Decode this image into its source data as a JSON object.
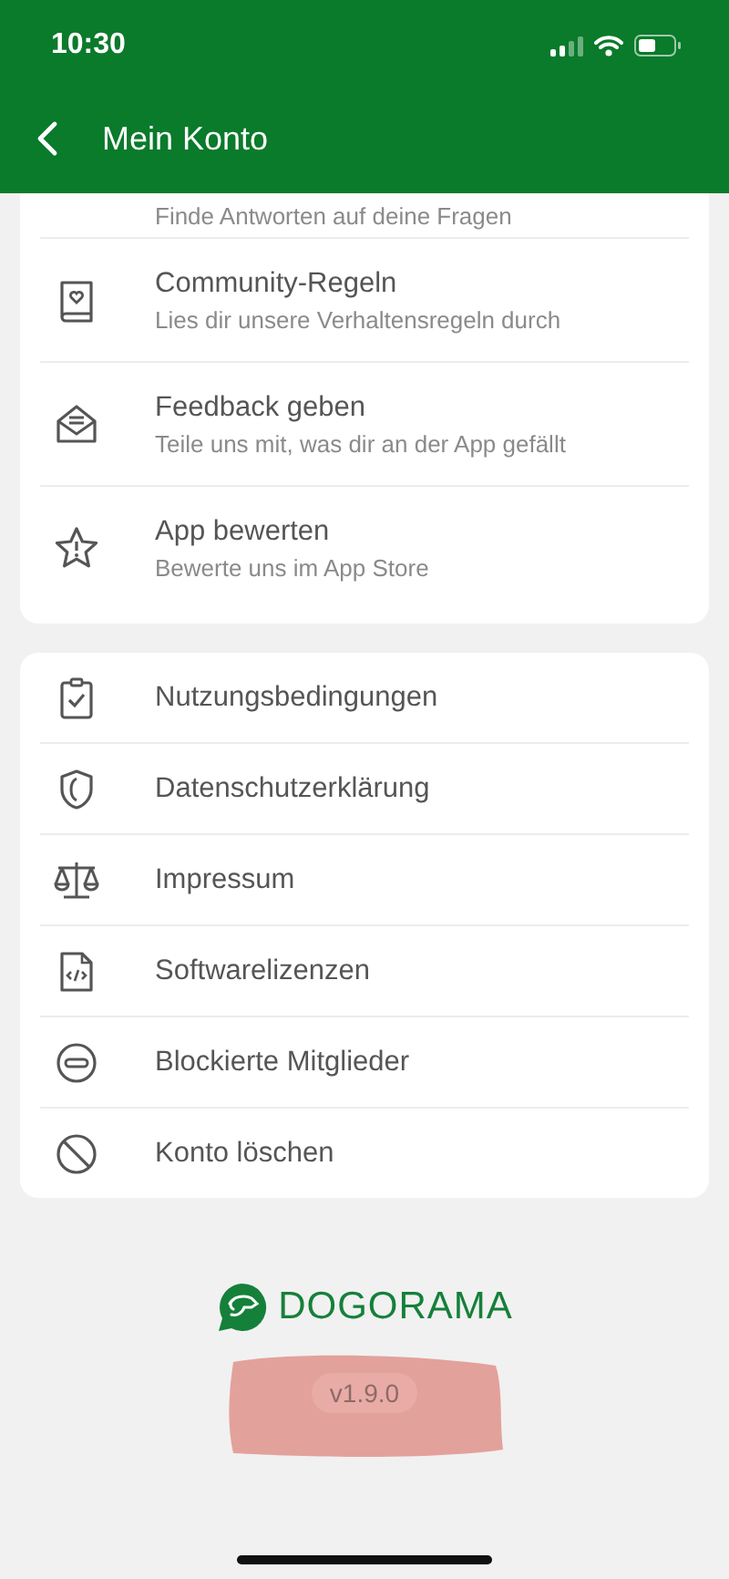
{
  "status_bar": {
    "time": "10:30"
  },
  "header": {
    "title": "Mein Konto"
  },
  "sections": [
    {
      "items": [
        {
          "subtitle": "Finde Antworten auf deine Fragen"
        },
        {
          "title": "Community-Regeln",
          "subtitle": "Lies dir unsere Verhaltensregeln durch"
        },
        {
          "title": "Feedback geben",
          "subtitle": "Teile uns mit, was dir an der App gefällt"
        },
        {
          "title": "App bewerten",
          "subtitle": "Bewerte uns im App Store"
        }
      ]
    },
    {
      "items": [
        {
          "title": "Nutzungsbedingungen"
        },
        {
          "title": "Datenschutzerklärung"
        },
        {
          "title": "Impressum"
        },
        {
          "title": "Softwarelizenzen"
        },
        {
          "title": "Blockierte Mitglieder"
        },
        {
          "title": "Konto löschen"
        }
      ]
    }
  ],
  "footer": {
    "logo_text": "DOGORAMA",
    "version": "v1.9.0"
  }
}
